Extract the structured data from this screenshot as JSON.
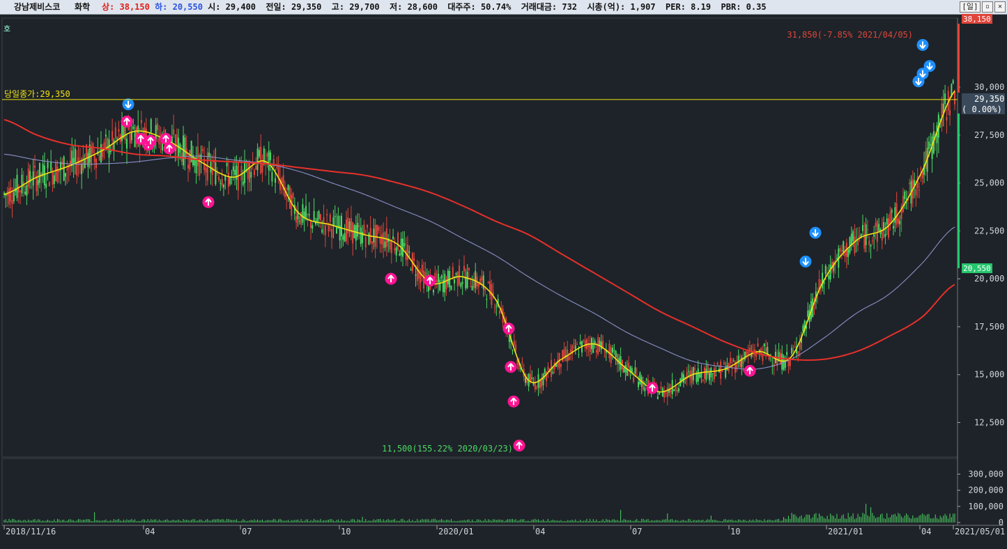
{
  "header": {
    "stock_name": "강남제비스코",
    "category": "화학",
    "upper_label": "상:",
    "upper_value": "38,150",
    "lower_label": "하:",
    "lower_value": "20,550",
    "info_text": "시: 29,400  전일: 29,350  고: 29,700  저: 28,600  대주주: 50.74%  거래대금: 732  시총(억): 1,907  PER: 8.19  PBR: 0.35",
    "period_button": "[일]"
  },
  "price_axis": {
    "ticks": [
      "30,000",
      "27,500",
      "25,000",
      "22,500",
      "20,000",
      "17,500",
      "15,000",
      "12,500"
    ],
    "top_label": "38,150",
    "current_label": "29,350",
    "change_label": "( 0.00%)",
    "lower_label": "20,550"
  },
  "volume_axis": {
    "ticks": [
      "300,000",
      "200,000",
      "100,000",
      "0"
    ]
  },
  "annotations": {
    "prev_close": "당일종가:29,350",
    "max_text": "31,850(-7.85% 2021/04/05)",
    "min_text": "11,500(155.22% 2020/03/23)",
    "corner_mark": "호"
  },
  "x_axis": {
    "labels": [
      "2018/11/16",
      "04",
      "07",
      "10",
      "2020/01",
      "04",
      "07",
      "10",
      "2021/01",
      "04",
      "2021/05/01"
    ]
  },
  "colors": {
    "background": "#1e2329",
    "up_candle": "#4cd964",
    "down_candle": "#e0453a",
    "ma_short": "#f2e413",
    "ma_mid": "#8a90c8",
    "ma_long": "#e8302a",
    "sell_signal": "#1e90ff",
    "buy_signal": "#ff1493"
  },
  "chart_data": {
    "type": "line",
    "subtype": "candlestick",
    "price_range": [
      10700,
      33600
    ],
    "x": [
      "2018-11",
      "2018-12",
      "2019-01",
      "2019-02",
      "2019-03",
      "2019-04",
      "2019-05",
      "2019-06",
      "2019-07",
      "2019-08",
      "2019-09",
      "2019-10",
      "2019-11",
      "2019-12",
      "2020-01",
      "2020-02",
      "2020-03",
      "2020-04",
      "2020-05",
      "2020-06",
      "2020-07",
      "2020-08",
      "2020-09",
      "2020-10",
      "2020-11",
      "2020-12",
      "2021-01",
      "2021-02",
      "2021-03",
      "2021-04"
    ],
    "series": [
      {
        "values": [
          24400,
          25300,
          25900,
          26700,
          27700,
          27200,
          26100,
          25300,
          26100,
          23400,
          22800,
          22300,
          21800,
          19800,
          20100,
          18900,
          14700,
          15800,
          16600,
          15300,
          14100,
          15000,
          15300,
          16200,
          15900,
          19900,
          22000,
          22800,
          25600,
          29800
        ]
      },
      {
        "values": [
          26500,
          26200,
          26000,
          26000,
          26100,
          26300,
          26400,
          26200,
          26000,
          25600,
          25000,
          24400,
          23700,
          23000,
          22100,
          21200,
          20100,
          19100,
          18200,
          17200,
          16400,
          15700,
          15400,
          15300,
          15800,
          16900,
          18200,
          19200,
          20800,
          22700
        ]
      },
      {
        "values": [
          28300,
          27500,
          27000,
          26800,
          26500,
          26400,
          26200,
          26100,
          26000,
          25800,
          25600,
          25400,
          25000,
          24500,
          23800,
          23000,
          22300,
          21300,
          20300,
          19300,
          18300,
          17500,
          16700,
          16100,
          15800,
          15800,
          16200,
          17000,
          18000,
          19700
        ]
      }
    ],
    "max_marker": {
      "date": "2021-04-05",
      "value": 31850
    },
    "min_marker": {
      "date": "2020-03-23",
      "value": 11500
    },
    "current_price": 29350,
    "volume": {
      "range": [
        0,
        380000
      ],
      "ticks": [
        0,
        100000,
        200000,
        300000
      ]
    }
  }
}
